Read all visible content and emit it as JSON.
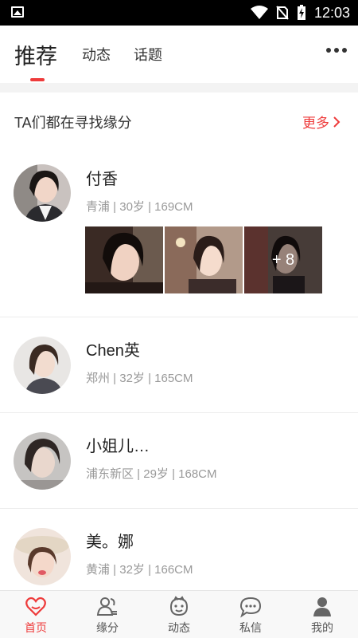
{
  "status_bar": {
    "time": "12:03"
  },
  "header": {
    "tabs": [
      {
        "label": "推荐"
      },
      {
        "label": "动态"
      },
      {
        "label": "话题"
      }
    ]
  },
  "section": {
    "title": "TA们都在寻找缘分",
    "more_label": "更多"
  },
  "users": [
    {
      "name": "付香",
      "meta": "青浦 | 30岁 | 169CM",
      "more_photos": "+ 8"
    },
    {
      "name": "Chen英",
      "meta": "郑州 | 32岁 | 165CM"
    },
    {
      "name": "小姐儿…",
      "meta": "浦东新区 | 29岁 | 168CM"
    },
    {
      "name": "美。娜",
      "meta": "黄浦 | 32岁 | 166CM"
    }
  ],
  "bottom_nav": [
    {
      "label": "首页",
      "icon": "heart-icon"
    },
    {
      "label": "缘分",
      "icon": "people-icon"
    },
    {
      "label": "动态",
      "icon": "face-icon"
    },
    {
      "label": "私信",
      "icon": "chat-icon"
    },
    {
      "label": "我的",
      "icon": "person-icon"
    }
  ],
  "colors": {
    "accent": "#ee3b3b",
    "text": "#333333",
    "muted": "#999999"
  }
}
